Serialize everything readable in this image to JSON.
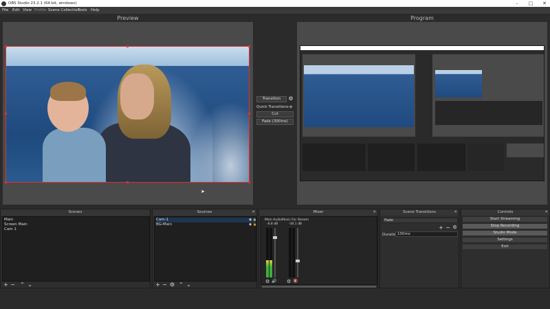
{
  "window": {
    "title": "OBS Studio 23.2.1 (64-bit, windows)",
    "min": "–",
    "max": "□",
    "close": "✕"
  },
  "menu": [
    "File",
    "Edit",
    "View",
    "Profile",
    "Scene Collection",
    "Tools",
    "Help"
  ],
  "labels": {
    "preview": "Preview",
    "program": "Program"
  },
  "transition": {
    "button": "Transition",
    "quick": "Quick Transitions",
    "cut": "Cut",
    "fade": "Fade (300ms)"
  },
  "docks": {
    "scenes": {
      "title": "Scenes",
      "items": [
        "Main",
        "Screen Main",
        "Cam 1"
      ]
    },
    "sources": {
      "title": "Sources",
      "items": [
        "Cam-1",
        "BG-Main"
      ]
    },
    "mixer": {
      "title": "Mixer",
      "channels": [
        {
          "name": "Main Audio",
          "db": "-6.8 dB",
          "level": 0.35
        },
        {
          "name": "Music For Stream",
          "db": "-30.1 dB",
          "level": 0
        }
      ]
    },
    "scene_transitions": {
      "title": "Scene Transitions",
      "type": "Fade",
      "duration_label": "Duration",
      "duration": "100ms"
    },
    "controls": {
      "title": "Controls",
      "buttons": [
        "Start Streaming",
        "Stop Recording",
        "Studio Mode",
        "Settings",
        "Exit"
      ]
    }
  },
  "icons": {
    "gear": "⚙",
    "plus": "+",
    "minus": "−",
    "up": "⌃",
    "down": "⌄",
    "eye": "◉",
    "lock": "🔒",
    "speaker": "🔊",
    "mute": "🔇",
    "cursor": "➤"
  },
  "colors": {
    "selection": "#e03030",
    "mute": "#e03030"
  }
}
